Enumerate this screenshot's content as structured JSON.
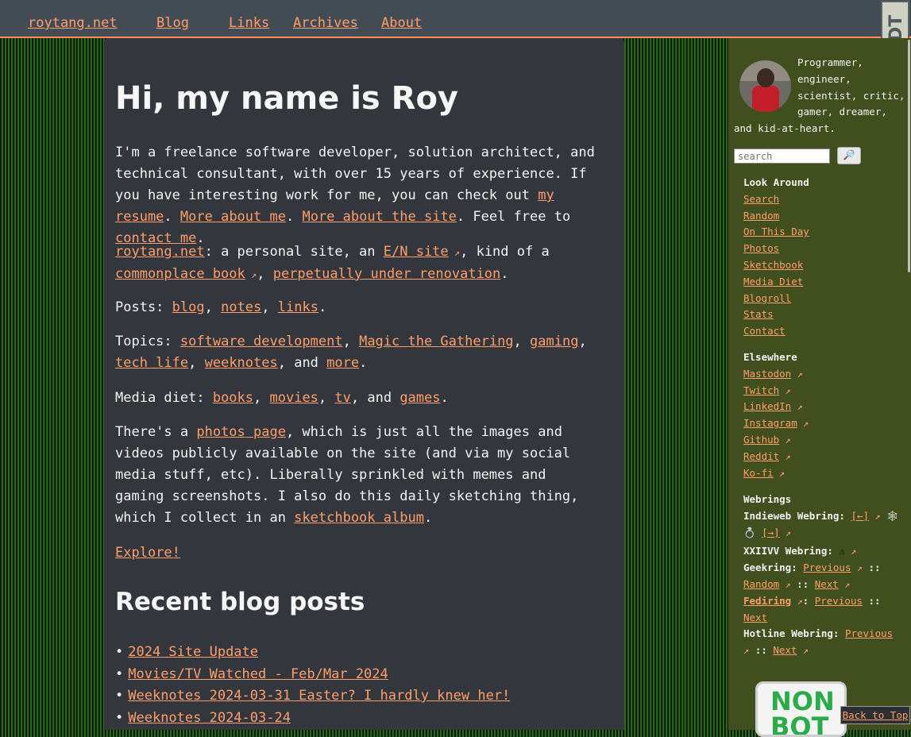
{
  "nav": {
    "site": "roytang.net",
    "items": [
      "Blog",
      "Links",
      "Archives",
      "About"
    ]
  },
  "badge": {
    "text": "DT"
  },
  "main": {
    "title": "Hi, my name is Roy",
    "intro": {
      "t1": "I'm a freelance software developer, solution architect, and technical consultant, with over 15 years of experience. If you have interesting work for me, you can check out ",
      "resume": "my resume",
      "t2": ". ",
      "more_about": "More about me",
      "t3": ". ",
      "more_site": "More about the site",
      "t4": ". Feel free to ",
      "contact": "contact me",
      "t5": "."
    },
    "site_para": {
      "site": "roytang.net",
      "t1": ": a personal site, an ",
      "en": "E/N site",
      "t2": ", kind of a ",
      "commonplace": "commonplace book",
      "t3": ", ",
      "renovation": "perpetually under renovation",
      "t4": "."
    },
    "posts_para": {
      "label": "Posts: ",
      "links": [
        "blog",
        "notes",
        "links"
      ]
    },
    "topics_para": {
      "label": "Topics: ",
      "links": [
        "software development",
        "Magic the Gathering",
        "gaming",
        "tech life",
        "weeknotes"
      ],
      "and": ", and ",
      "more": "more"
    },
    "media_para": {
      "label": "Media diet: ",
      "links": [
        "books",
        "movies",
        "tv"
      ],
      "and": ", and ",
      "games": "games"
    },
    "photos_para": {
      "t1": "There's a ",
      "photos": "photos page",
      "t2": ", which is just all the images and videos publicly available on the site (and via my social media stuff, etc). Liberally sprinkled with memes and gaming screenshots. I also do this daily sketching thing, which I collect in an ",
      "sketchbook": "sketchbook album",
      "t3": "."
    },
    "explore": "Explore!",
    "recent_heading": "Recent blog posts",
    "recent_posts": [
      "2024 Site Update",
      "Movies/TV Watched - Feb/Mar 2024",
      "Weeknotes 2024-03-31 Easter? I hardly knew her!",
      "Weeknotes 2024-03-24"
    ]
  },
  "sidebar": {
    "bio": "Programmer, engineer, scientist, critic, gamer, dreamer, and kid-at-heart.",
    "search_placeholder": "search",
    "look_around": {
      "heading": "Look Around",
      "items": [
        "Search",
        "Random",
        "On This Day",
        "Photos",
        "Sketchbook",
        "Media Diet",
        "Blogroll",
        "Stats",
        "Contact"
      ]
    },
    "elsewhere": {
      "heading": "Elsewhere",
      "items": [
        "Mastodon",
        "Twitch",
        "LinkedIn",
        "Instagram",
        "Github",
        "Reddit",
        "Ko-fi"
      ]
    },
    "webrings": {
      "heading": "Webrings",
      "indieweb": "Indieweb Webring:",
      "prev_arrow": "[←]",
      "next_arrow": "[→]",
      "xxiivv": "XXIIVV Webring:",
      "geekring": "Geekring:",
      "previous": "Previous",
      "random": "Random",
      "next": "Next",
      "fediring": "Fediring",
      "hotline": "Hotline Webring:",
      "sep": "::"
    },
    "nonbot": {
      "line1": "NON",
      "line2": "BOT"
    },
    "back_to_top": "Back to Top"
  }
}
